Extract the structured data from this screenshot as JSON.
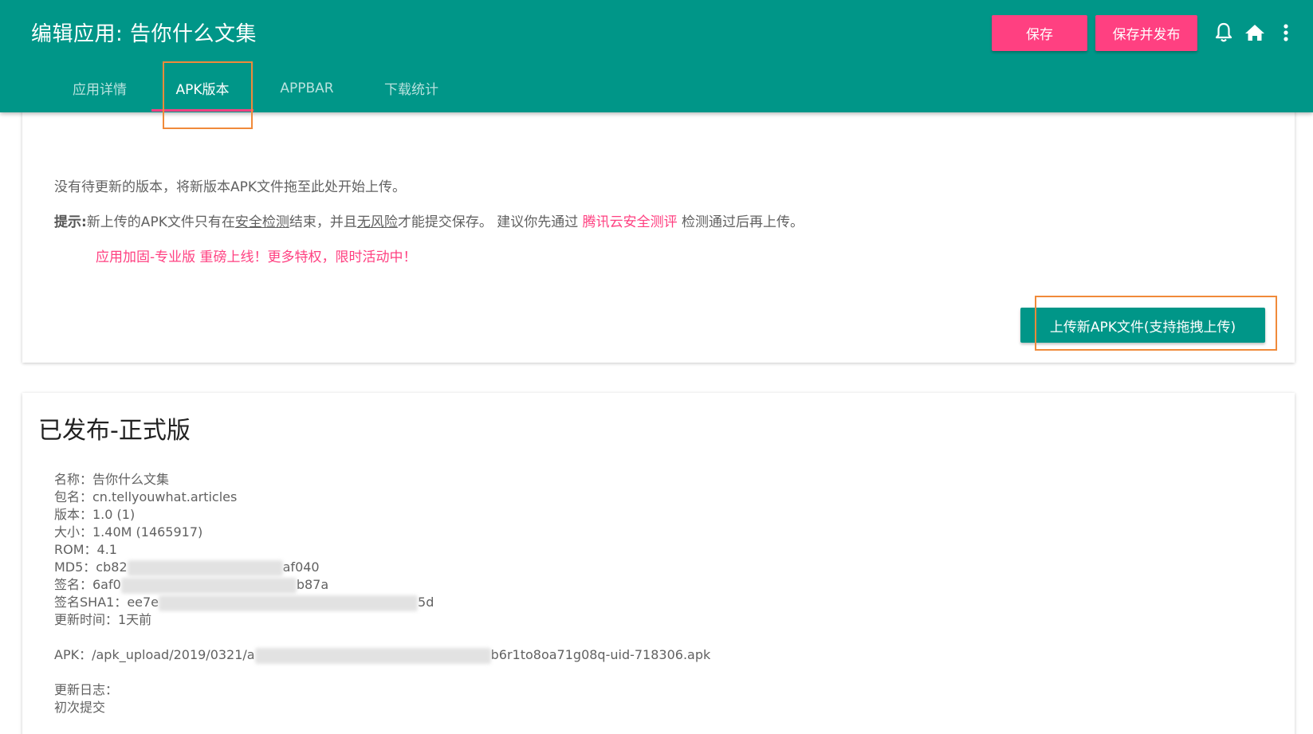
{
  "header": {
    "title": "编辑应用: 告你什么文集",
    "save_label": "保存",
    "publish_label": "保存并发布",
    "icons": [
      "bell-icon",
      "home-icon",
      "more-vert-icon"
    ]
  },
  "tabs": [
    {
      "label": "应用详情",
      "active": false
    },
    {
      "label": "APK版本",
      "active": true
    },
    {
      "label": "APPBAR",
      "active": false
    },
    {
      "label": "下载统计",
      "active": false
    }
  ],
  "colors": {
    "primary": "#009688",
    "accent": "#ff4081",
    "highlight_box": "#f08a3a"
  },
  "upload": {
    "message": "没有待更新的版本，将新版本APK文件拖至此处开始上传。",
    "tip_label": "提示:",
    "tip_part1": "新上传的APK文件只有在",
    "tip_underline1": "安全检测",
    "tip_part2": "结束，并且",
    "tip_underline2": "无风险",
    "tip_part3": "才能提交保存。 建议你先通过 ",
    "tip_link": "腾讯云安全测评",
    "tip_part4": " 检测通过后再上传。",
    "promo_link": "应用加固-专业版",
    "promo_text": " 重磅上线！更多特权，限时活动中！",
    "button_label": "上传新APK文件(支持拖拽上传)"
  },
  "published": {
    "title": "已发布-正式版",
    "name": "名称：告你什么文集",
    "package": "包名：cn.tellyouwhat.articles",
    "version": "版本：1.0 (1)",
    "size": "大小：1.40M (1465917)",
    "rom": "ROM：4.1",
    "md5_prefix": "MD5：cb82",
    "md5_suffix": "af040",
    "signature_prefix": "签名：6af0",
    "signature_suffix": "b87a",
    "sha1_prefix": "签名SHA1：ee7e",
    "sha1_suffix": "5d",
    "updated": "更新时间：1天前",
    "apk_prefix": "APK：/apk_upload/2019/0321/a",
    "apk_suffix": "b6r1to8oa71g08q-uid-718306.apk",
    "changelog_label": "更新日志：",
    "changelog": "初次提交"
  }
}
